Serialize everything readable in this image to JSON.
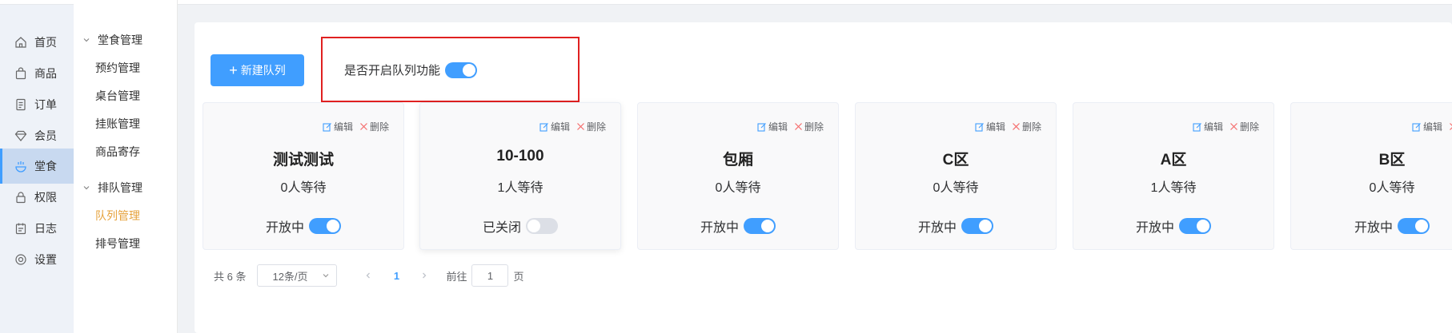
{
  "nav": {
    "items": [
      {
        "label": "首页",
        "icon": "home-icon"
      },
      {
        "label": "商品",
        "icon": "bag-icon"
      },
      {
        "label": "订单",
        "icon": "order-icon"
      },
      {
        "label": "会员",
        "icon": "diamond-icon"
      },
      {
        "label": "堂食",
        "icon": "dine-icon"
      },
      {
        "label": "权限",
        "icon": "lock-icon"
      },
      {
        "label": "日志",
        "icon": "log-icon"
      },
      {
        "label": "设置",
        "icon": "gear-icon"
      }
    ],
    "active_index": 4
  },
  "submenu": {
    "groups": [
      {
        "label": "堂食管理",
        "items": [
          "预约管理",
          "桌台管理",
          "挂账管理",
          "商品寄存"
        ]
      },
      {
        "label": "排队管理",
        "items": [
          "队列管理",
          "排号管理"
        ]
      }
    ],
    "active_item": "队列管理"
  },
  "toolbar": {
    "new_button_label": "新建队列",
    "queue_toggle_label": "是否开启队列功能",
    "queue_toggle_on": true,
    "highlight_color": "#e02020"
  },
  "card_actions": {
    "edit": "编辑",
    "delete": "删除"
  },
  "cards": [
    {
      "title": "测试测试",
      "waiting": "0人等待",
      "status": "开放中",
      "on": true
    },
    {
      "title": "10-100",
      "waiting": "1人等待",
      "status": "已关闭",
      "on": false
    },
    {
      "title": "包厢",
      "waiting": "0人等待",
      "status": "开放中",
      "on": true
    },
    {
      "title": "C区",
      "waiting": "0人等待",
      "status": "开放中",
      "on": true
    },
    {
      "title": "A区",
      "waiting": "1人等待",
      "status": "开放中",
      "on": true
    },
    {
      "title": "B区",
      "waiting": "0人等待",
      "status": "开放中",
      "on": true
    }
  ],
  "pagination": {
    "total": "共 6 条",
    "page_size": "12条/页",
    "current_page": "1",
    "goto_label": "前往",
    "goto_value": "1",
    "page_suffix": "页"
  },
  "colors": {
    "primary": "#409eff",
    "active_submenu": "#e6a23c"
  }
}
